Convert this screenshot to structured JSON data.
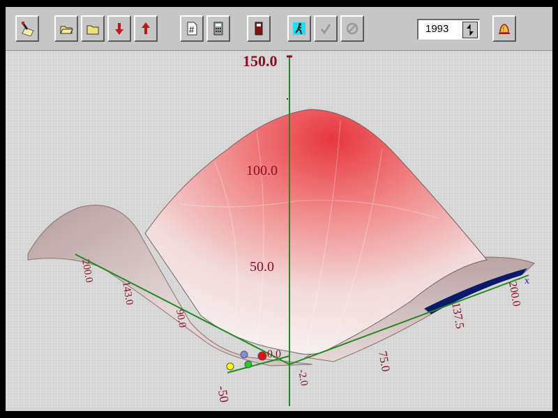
{
  "toolbar": {
    "buttons": [
      {
        "id": "brush",
        "icon": "paintbrush-icon"
      },
      {
        "id": "open",
        "icon": "folder-open-icon"
      },
      {
        "id": "folder",
        "icon": "folder-icon"
      },
      {
        "id": "down",
        "icon": "arrow-down-icon"
      },
      {
        "id": "up",
        "icon": "arrow-up-icon"
      },
      {
        "id": "grid",
        "icon": "hash-sheet-icon"
      },
      {
        "id": "calc",
        "icon": "calculator-icon"
      },
      {
        "id": "device",
        "icon": "phone-device-icon"
      },
      {
        "id": "run",
        "icon": "running-man-icon"
      },
      {
        "id": "check",
        "icon": "checkmark-icon"
      },
      {
        "id": "cancel",
        "icon": "no-symbol-icon"
      },
      {
        "id": "alarm",
        "icon": "alarm-bell-icon"
      }
    ],
    "year": "1993"
  },
  "plot": {
    "vertical_axis": {
      "ticks": [
        "150.0",
        "100.0",
        "50.0"
      ]
    },
    "right_axis": {
      "ticks": [
        "75.0",
        "137.5",
        "200.0"
      ],
      "end_label": "x"
    },
    "left_axis": {
      "ticks": [
        "200.0",
        "143.0",
        "90.0"
      ]
    },
    "origin_labels": {
      "bottom_left": "-50",
      "origin": "0.0",
      "origin_minus": "-2.0"
    },
    "colors": {
      "peak": "#e8323a",
      "axis": "#1f8a1f",
      "label": "#8b0f22",
      "accent_band": "#0a1a6a"
    },
    "markers": [
      "#ffff00",
      "#8a8ad8",
      "#22cc22",
      "#dd1111"
    ]
  }
}
